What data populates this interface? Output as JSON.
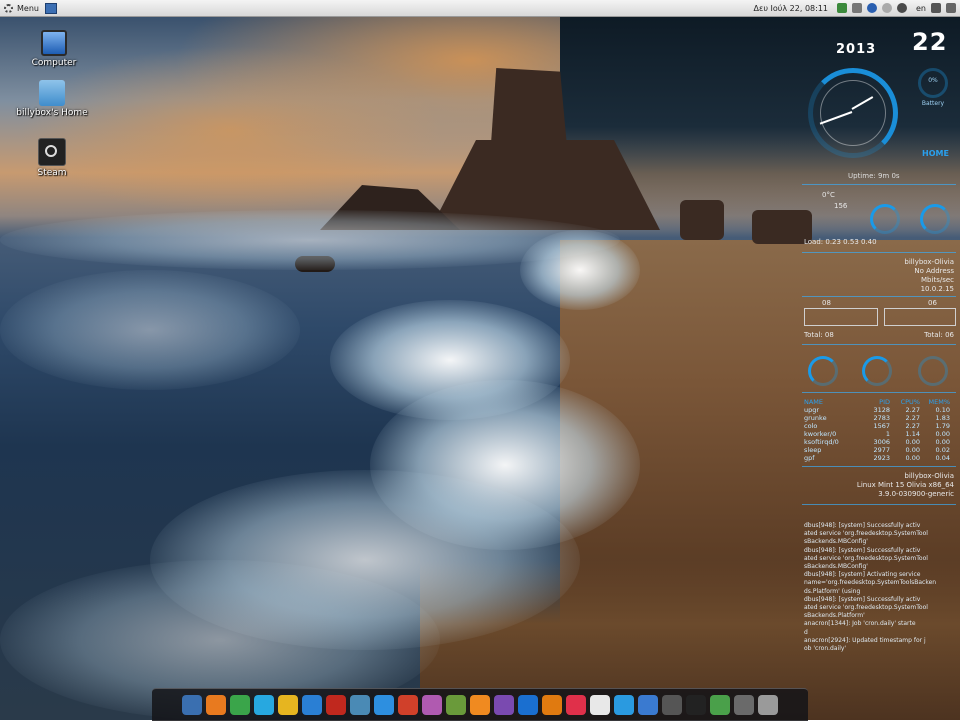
{
  "top_panel": {
    "menu_label": "Menu",
    "datetime": "Δευ Ιούλ 22, 08:11",
    "keyboard_layout": "en"
  },
  "desktop_icons": [
    {
      "label": "Computer"
    },
    {
      "label": "billybox's Home"
    },
    {
      "label": "Steam"
    }
  ],
  "conky": {
    "year": "2013",
    "day": "22",
    "battery_pct": "0%",
    "battery_label": "Battery",
    "home_label": "HOME",
    "uptime": "Uptime: 9m 0s",
    "temp": "0°C",
    "load_value": "156",
    "loads": "Load: 0.23 0.53 0.40",
    "hostname": "billybox-Olivia",
    "net_status": "No Address",
    "net_speed": "Mbits/sec",
    "ip": "10.0.2.15",
    "up_down_left": "08",
    "up_down_right": "06",
    "total_left": "Total: 08",
    "total_right": "Total: 06",
    "proc_headers": [
      "NAME",
      "PID",
      "CPU%",
      "MEM%"
    ],
    "processes": [
      [
        "upgr",
        "3128",
        "2.27",
        "0.10"
      ],
      [
        "grunke",
        "2783",
        "2.27",
        "1.83"
      ],
      [
        "colo",
        "1567",
        "2.27",
        "1.79"
      ],
      [
        "kworker/0",
        "1",
        "1.14",
        "0.00"
      ],
      [
        "ksoftirqd/0",
        "3006",
        "0.00",
        "0.00"
      ],
      [
        "sleep",
        "2977",
        "0.00",
        "0.02"
      ],
      [
        "gpf",
        "2923",
        "0.00",
        "0.04"
      ]
    ],
    "sys_host": "billybox-Olivia",
    "sys_os": "Linux Mint 15 Olivia x86_64",
    "sys_kernel": "3.9.0-030900-generic",
    "log_lines": [
      "dbus[948]: [system] Successfully activ",
      "ated service 'org.freedesktop.SystemTool",
      "sBackends.MBConfig'",
      "dbus[948]: [system] Successfully activ",
      "ated service 'org.freedesktop.SystemTool",
      "sBackends.MBConfig'",
      "dbus[948]: [system] Activating service",
      "name='org.freedesktop.SystemToolsBacken",
      "ds.Platform' (using",
      "dbus[948]: [system] Successfully activ",
      "ated service 'org.freedesktop.SystemTool",
      "sBackends.Platform'",
      "anacron[1344]: Job 'cron.daily' starte",
      "d",
      "anacron[2924]: Updated timestamp for j",
      "ob 'cron.daily'"
    ]
  },
  "dock_items": [
    "anchor-icon",
    "firefox-icon",
    "chrome-icon",
    "skype-icon",
    "sticky-icon",
    "thunderbird-icon",
    "filezilla-icon",
    "wine-icon",
    "dropbox-icon",
    "record-icon",
    "paint-icon",
    "frog-icon",
    "rss-icon",
    "headphones-icon",
    "player-icon",
    "vlc-icon",
    "color-wheel-icon",
    "document-icon",
    "clementine-icon",
    "bird-icon",
    "window-icon",
    "terminal-icon",
    "plant-icon",
    "monitor-icon",
    "trash-icon"
  ],
  "dock_colors": [
    "#3a6fb0",
    "#e87a1f",
    "#3aa54a",
    "#27a8e0",
    "#e6b520",
    "#2a7fd4",
    "#c0281e",
    "#4a8ab5",
    "#2d8fe0",
    "#d0402a",
    "#b05ab0",
    "#6a9a3a",
    "#f08a20",
    "#7a4ab0",
    "#1a6fd0",
    "#e07a10",
    "#e0304a",
    "#e8e8e8",
    "#2a9ae0",
    "#3a7ad0",
    "#555555",
    "#222222",
    "#4aa04a",
    "#6a6a6a",
    "#9a9a9a"
  ]
}
